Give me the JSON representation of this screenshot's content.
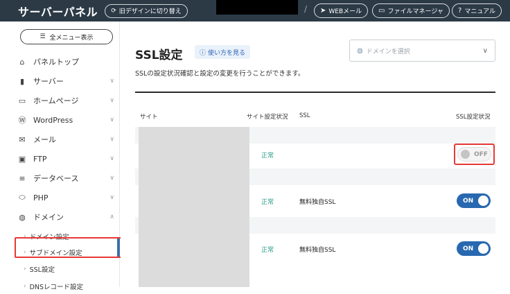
{
  "header": {
    "logo": "サーバーパネル",
    "old_design": "旧デザインに切り替え",
    "webmail": "WEBメール",
    "file_manager": "ファイルマネージャ",
    "manual": "マニュアル"
  },
  "sidebar": {
    "menu_button": "全メニュー表示",
    "items": [
      {
        "label": "パネルトップ"
      },
      {
        "label": "サーバー"
      },
      {
        "label": "ホームページ"
      },
      {
        "label": "WordPress"
      },
      {
        "label": "メール"
      },
      {
        "label": "FTP"
      },
      {
        "label": "データベース"
      },
      {
        "label": "PHP"
      },
      {
        "label": "ドメイン"
      }
    ],
    "sub_items": [
      {
        "label": "ドメイン設定"
      },
      {
        "label": "サブドメイン設定"
      },
      {
        "label": "SSL設定"
      },
      {
        "label": "DNSレコード設定"
      }
    ]
  },
  "main": {
    "title": "SSL設定",
    "howto": "使い方を見る",
    "domain_placeholder": "ドメインを選択",
    "description": "SSLの設定状況確認と設定の変更を行うことができます。",
    "columns": {
      "site": "サイト",
      "site_status": "サイト設定状況",
      "ssl": "SSL",
      "ssl_status": "SSL設定状況"
    },
    "rows": [
      {
        "status": "正常",
        "ssl": "",
        "toggle": "OFF"
      },
      {
        "status": "正常",
        "ssl": "無料独自SSL",
        "toggle": "ON"
      },
      {
        "status": "正常",
        "ssl": "無料独自SSL",
        "toggle": "ON"
      }
    ]
  },
  "colors": {
    "header_bg": "#2c3a46",
    "accent_blue": "#2868b0",
    "status_green": "#2e9b87",
    "highlight_red": "#e53935"
  }
}
